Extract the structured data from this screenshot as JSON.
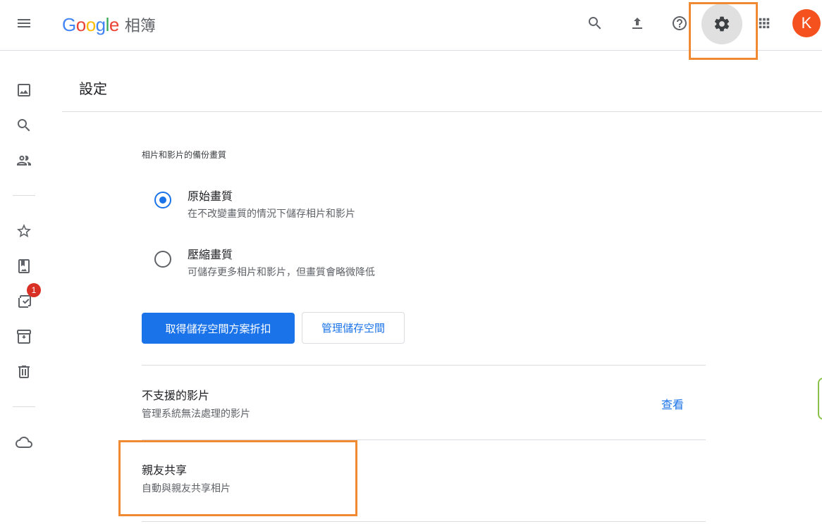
{
  "header": {
    "logo": {
      "letters": [
        {
          "ch": "G",
          "color": "#4285F4"
        },
        {
          "ch": "o",
          "color": "#EA4335"
        },
        {
          "ch": "o",
          "color": "#FBBC05"
        },
        {
          "ch": "g",
          "color": "#4285F4"
        },
        {
          "ch": "l",
          "color": "#34A853"
        },
        {
          "ch": "e",
          "color": "#EA4335"
        }
      ],
      "product": "相簿"
    },
    "icons": [
      "menu-icon",
      "search-icon",
      "upload-icon",
      "help-icon",
      "settings-icon",
      "apps-icon"
    ],
    "avatar_letter": "K",
    "avatar_color": "#f4511e"
  },
  "sidebar": {
    "icons": [
      "photos-icon",
      "search-icon",
      "people-icon",
      "star-icon",
      "album-icon",
      "utilities-icon",
      "archive-icon",
      "trash-icon",
      "cloud-icon"
    ],
    "badge_count": "1"
  },
  "settings": {
    "page_title": "設定",
    "backup_quality_label": "相片和影片的備份畫質",
    "options": [
      {
        "title": "原始畫質",
        "description": "在不改變畫質的情況下儲存相片和影片",
        "selected": true
      },
      {
        "title": "壓縮畫質",
        "description": "可儲存更多相片和影片，但畫質會略微降低",
        "selected": false
      }
    ],
    "primary_button": "取得儲存空間方案折扣",
    "secondary_button": "管理儲存空間",
    "unsupported": {
      "title": "不支援的影片",
      "description": "管理系統無法處理的影片",
      "link": "查看"
    },
    "partner_sharing": {
      "title": "親友共享",
      "description": "自動與親友共享相片"
    }
  },
  "colors": {
    "accent": "#1a73e8",
    "highlight": "#f08a32",
    "badge": "#d93025"
  }
}
